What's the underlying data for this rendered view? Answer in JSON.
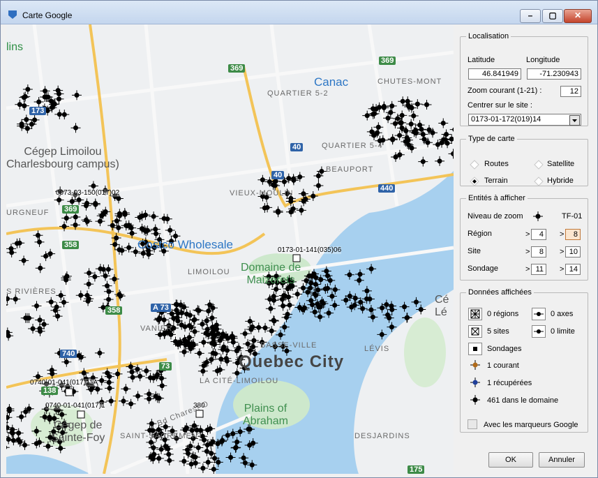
{
  "window": {
    "title": "Carte Google"
  },
  "map": {
    "city_label": "Quebec City",
    "labels": {
      "quartier52": "QUARTIER 5-2",
      "chutes": "CHUTES-MONT",
      "quartier54": "QUARTIER 5-4",
      "beauport": "BEAUPORT",
      "vieux_moulin": "VIEUX-MOULIN",
      "limoilou": "LIMOILOU",
      "vanier": "VANIER",
      "basse_ville": "BASSE-VILLE",
      "cite_limoilou": "LA CITÉ-LIMOILOU",
      "levis": "LÉVIS",
      "desjardins": "DESJARDINS",
      "saint_sacrement": "SAINT-SACREMENT",
      "urgneuf": "URGNEUF",
      "rivieres": "S RIVIÈRES",
      "bd_charest": "Bd Charest O",
      "lins": "lins",
      "canac": "Canac",
      "cegep_limoilou": "Cégep Limoilou\nCharlesbourg campus)",
      "costco": "Costco Wholesale",
      "domaine": "Domaine de\nMaizerets",
      "plains": "Plains of\nAbraham",
      "cegep_foy": "Cégep de\nSainte-Foy",
      "cegep_right": "Cé\nLé"
    },
    "shields": {
      "r369a": "369",
      "r369b": "369",
      "r369c": "369",
      "r40a": "40",
      "r40b": "40",
      "r440": "440",
      "r358a": "358",
      "r358b": "358",
      "r740": "740",
      "r138": "138",
      "r175": "175",
      "r173": "173",
      "r73": "73",
      "a73": "A 73"
    },
    "site_labels": {
      "s1": "0073-03-150(017)02",
      "s2": "0173-01-141(035)06",
      "s3": "0740-01-041(017)11A",
      "s4": "0740-01-041(017)1",
      "s5": "380"
    }
  },
  "localisation": {
    "legend": "Localisation",
    "latitude_label": "Latitude",
    "longitude_label": "Longitude",
    "latitude": "46.841949",
    "longitude": "-71.230943",
    "zoom_label": "Zoom courant (1-21) :",
    "zoom": "12",
    "center_label": "Centrer sur le site :",
    "center_value": "0173-01-172(019)14"
  },
  "map_type": {
    "legend": "Type de carte",
    "options": [
      "Routes",
      "Satellite",
      "Terrain",
      "Hybride"
    ],
    "selected": "Terrain"
  },
  "entities": {
    "legend": "Entités à afficher",
    "zoom_header": "Niveau de zoom",
    "tf_header": "TF-01",
    "rows": [
      {
        "label": "Région",
        "min": "4",
        "max": "8"
      },
      {
        "label": "Site",
        "min": "8",
        "max": "10"
      },
      {
        "label": "Sondage",
        "min": "11",
        "max": "14"
      }
    ],
    "gt": ">"
  },
  "data_shown": {
    "legend": "Données affichées",
    "regions": "0 régions",
    "axes": "0 axes",
    "sites": "5 sites",
    "limit": "0 limite",
    "sondages": "Sondages",
    "current": "1 courant",
    "recovered": "1 récupérées",
    "in_domain": "461 dans le domaine",
    "colors": {
      "current": "#b06a1a",
      "recovered": "#1f3f9a",
      "domain": "#000000"
    }
  },
  "google_markers_label": "Avec les marqueurs Google",
  "buttons": {
    "ok": "OK",
    "cancel": "Annuler"
  }
}
